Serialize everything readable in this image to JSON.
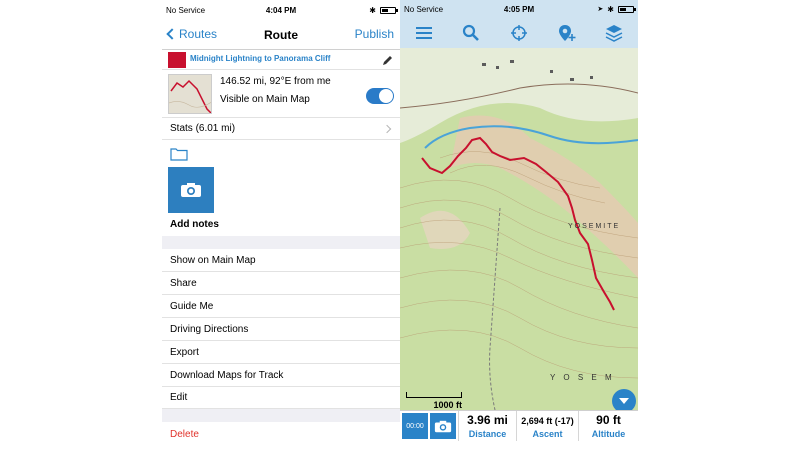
{
  "left": {
    "status": {
      "carrier": "No Service",
      "time": "4:04 PM"
    },
    "nav": {
      "back_label": "Routes",
      "title": "Route",
      "publish_label": "Publish"
    },
    "route": {
      "name": "Midnight Lightning to Panorama Cliff",
      "color": "#c8102e",
      "distance": "146.52 mi, 92°E from me",
      "visible_label": "Visible on Main Map",
      "visible_on": true
    },
    "stats_label": "Stats (6.01 mi)",
    "add_notes": "Add notes",
    "menu": [
      "Show on Main Map",
      "Share",
      "Guide Me",
      "Driving Directions",
      "Export",
      "Download Maps for Track",
      "Edit"
    ],
    "delete_label": "Delete"
  },
  "right": {
    "status": {
      "carrier": "No Service",
      "time": "4:05 PM"
    },
    "toolbar": [
      "menu-icon",
      "search-icon",
      "crosshair-icon",
      "add-pin-icon",
      "layers-icon"
    ],
    "map_labels": [
      "YOSEMITE",
      "Y O S E M"
    ],
    "scale_label": "1000 ft",
    "record_label": "00:00",
    "stats": [
      {
        "value": "3.96 mi",
        "label": "Distance"
      },
      {
        "value": "2,694 ft (-17)",
        "label": "Ascent"
      },
      {
        "value": "90 ft",
        "label": "Altitude"
      }
    ]
  },
  "colors": {
    "accent": "#2a83c8",
    "route": "#c8102e",
    "delete": "#e0322b"
  }
}
